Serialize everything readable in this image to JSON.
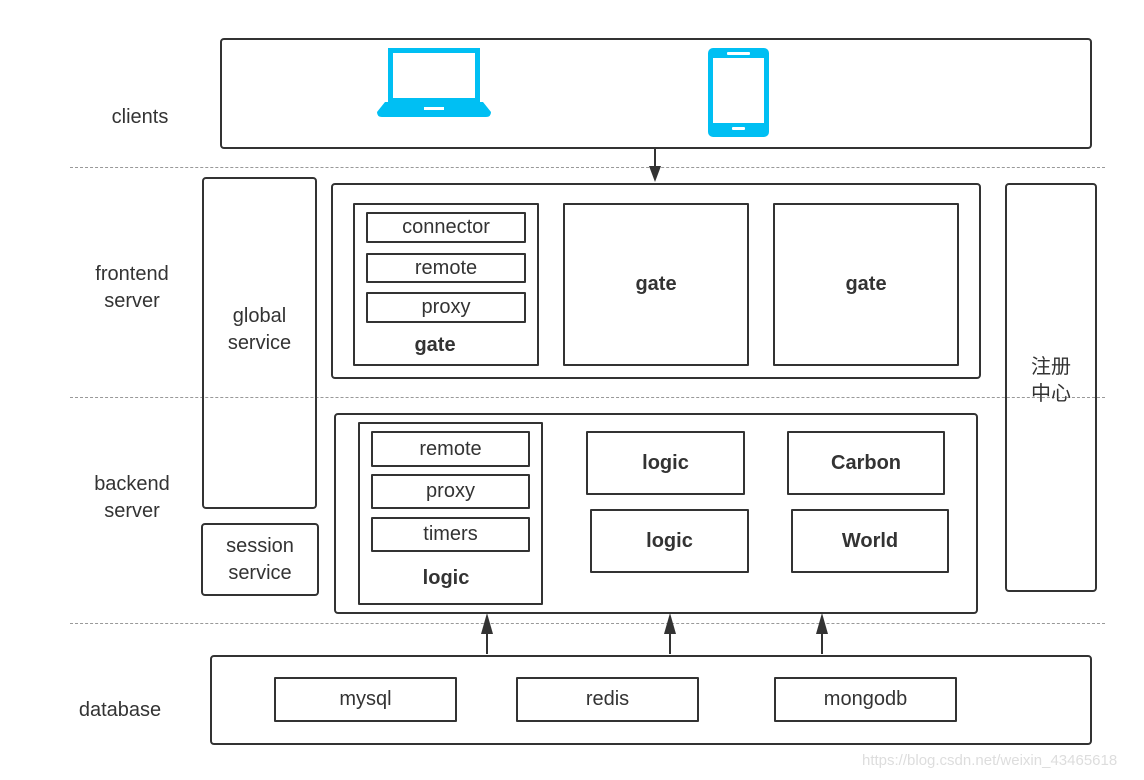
{
  "layers": {
    "clients": "clients",
    "frontend": "frontend\nserver",
    "backend": "backend\nserver",
    "database": "database"
  },
  "clients": {
    "icons": [
      "laptop-icon",
      "phone-icon"
    ],
    "icon_color": "#00BFF3"
  },
  "global_service": "global\nservice",
  "session_service": "session\nservice",
  "registry": "注册\n中心",
  "frontend": {
    "gate_detail": {
      "components": [
        "connector",
        "remote",
        "proxy"
      ],
      "label": "gate"
    },
    "gates": [
      "gate",
      "gate"
    ]
  },
  "backend": {
    "logic_detail": {
      "components": [
        "remote",
        "proxy",
        "timers"
      ],
      "label": "logic"
    },
    "servers": [
      "logic",
      "Carbon",
      "logic",
      "World"
    ]
  },
  "database": {
    "items": [
      "mysql",
      "redis",
      "mongodb"
    ]
  },
  "watermark": "https://blog.csdn.net/weixin_43465618"
}
